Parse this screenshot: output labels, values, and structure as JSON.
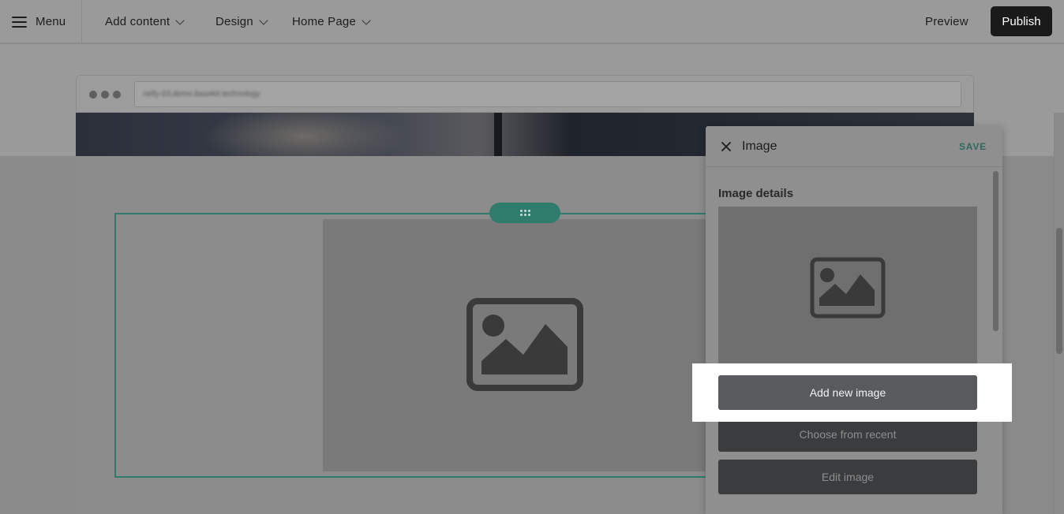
{
  "topbar": {
    "menu_label": "Menu",
    "nav": [
      {
        "label": "Add content"
      },
      {
        "label": "Design"
      },
      {
        "label": "Home Page"
      }
    ],
    "preview_label": "Preview",
    "publish_label": "Publish"
  },
  "browser": {
    "url": "nelly-03.demo.basekit.technology"
  },
  "panel": {
    "title": "Image",
    "save_label": "SAVE",
    "section_title": "Image details",
    "buttons": {
      "add_new": "Add new image",
      "choose_recent": "Choose from recent",
      "edit": "Edit image"
    }
  },
  "colors": {
    "accent": "#2f7b6c",
    "publish_bg": "#1a1a1a"
  },
  "icons": [
    "hamburger-icon",
    "chevron-down-icon",
    "close-icon",
    "drag-handle-icon",
    "image-placeholder-icon"
  ]
}
